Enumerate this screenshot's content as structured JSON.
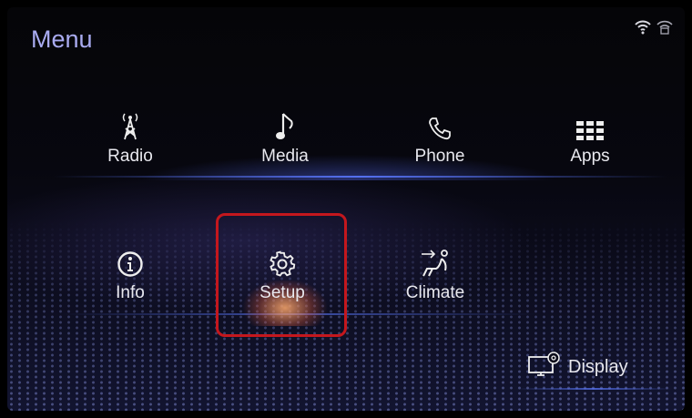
{
  "header": {
    "title": "Menu"
  },
  "status_icons": [
    "wifi-icon",
    "wifi-hotspot-icon"
  ],
  "top_row": [
    {
      "label": "Radio",
      "icon": "radio-tower-icon"
    },
    {
      "label": "Media",
      "icon": "music-note-icon"
    },
    {
      "label": "Phone",
      "icon": "phone-icon"
    },
    {
      "label": "Apps",
      "icon": "apps-grid-icon"
    }
  ],
  "bottom_row": [
    {
      "label": "Info",
      "icon": "info-icon"
    },
    {
      "label": "Setup",
      "icon": "gear-icon",
      "selected": true
    },
    {
      "label": "Climate",
      "icon": "seat-airflow-icon"
    }
  ],
  "display_button": {
    "label": "Display",
    "icon": "display-settings-icon"
  },
  "colors": {
    "title": "#a9abf0",
    "focus": "#c4171d",
    "accent_glow": "#5a78ff"
  }
}
